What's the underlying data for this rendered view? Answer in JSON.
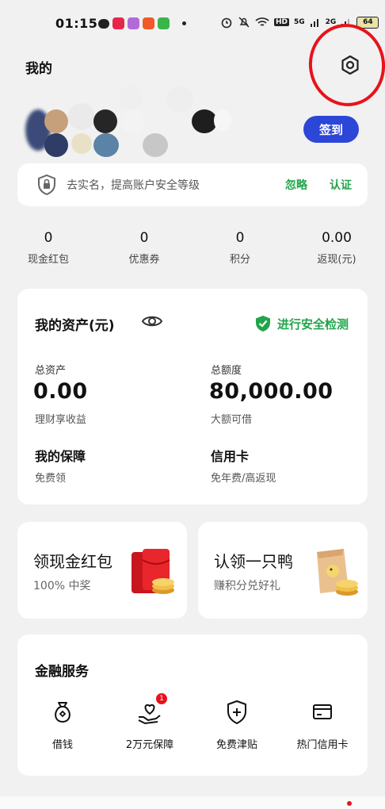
{
  "status_bar": {
    "time": "01:15",
    "network_5g": "5G",
    "network_2g": "2G",
    "hd": "HD",
    "battery": "64"
  },
  "header": {
    "title": "我的"
  },
  "profile": {
    "checkin_label": "签到"
  },
  "security": {
    "text": "去实名，提高账户安全等级",
    "ignore": "忽略",
    "verify": "认证"
  },
  "stats": [
    {
      "value": "0",
      "label": "现金红包"
    },
    {
      "value": "0",
      "label": "优惠券"
    },
    {
      "value": "0",
      "label": "积分"
    },
    {
      "value": "0.00",
      "label": "返现(元)"
    }
  ],
  "assets": {
    "title": "我的资产(元)",
    "security_check": "进行安全检测",
    "total_label": "总资产",
    "total_value": "0.00",
    "total_sub": "理财享收益",
    "quota_label": "总额度",
    "quota_value": "80,000.00",
    "quota_sub": "大额可借",
    "insurance_title": "我的保障",
    "insurance_sub": "免费领",
    "card_title": "信用卡",
    "card_sub": "免年费/高返现"
  },
  "promos": [
    {
      "title": "领现金红包",
      "sub": "100% 中奖"
    },
    {
      "title": "认领一只鸭",
      "sub": "赚积分兑好礼"
    }
  ],
  "finance": {
    "title": "金融服务",
    "items": [
      {
        "label": "借钱",
        "icon": "money-bag-icon"
      },
      {
        "label": "2万元保障",
        "icon": "hand-heart-icon",
        "badge": "1"
      },
      {
        "label": "免费津贴",
        "icon": "shield-plus-icon"
      },
      {
        "label": "热门信用卡",
        "icon": "credit-card-icon"
      }
    ]
  },
  "colors": {
    "accent_blue": "#2c46d8",
    "green": "#21a54a",
    "red": "#e8131a"
  }
}
